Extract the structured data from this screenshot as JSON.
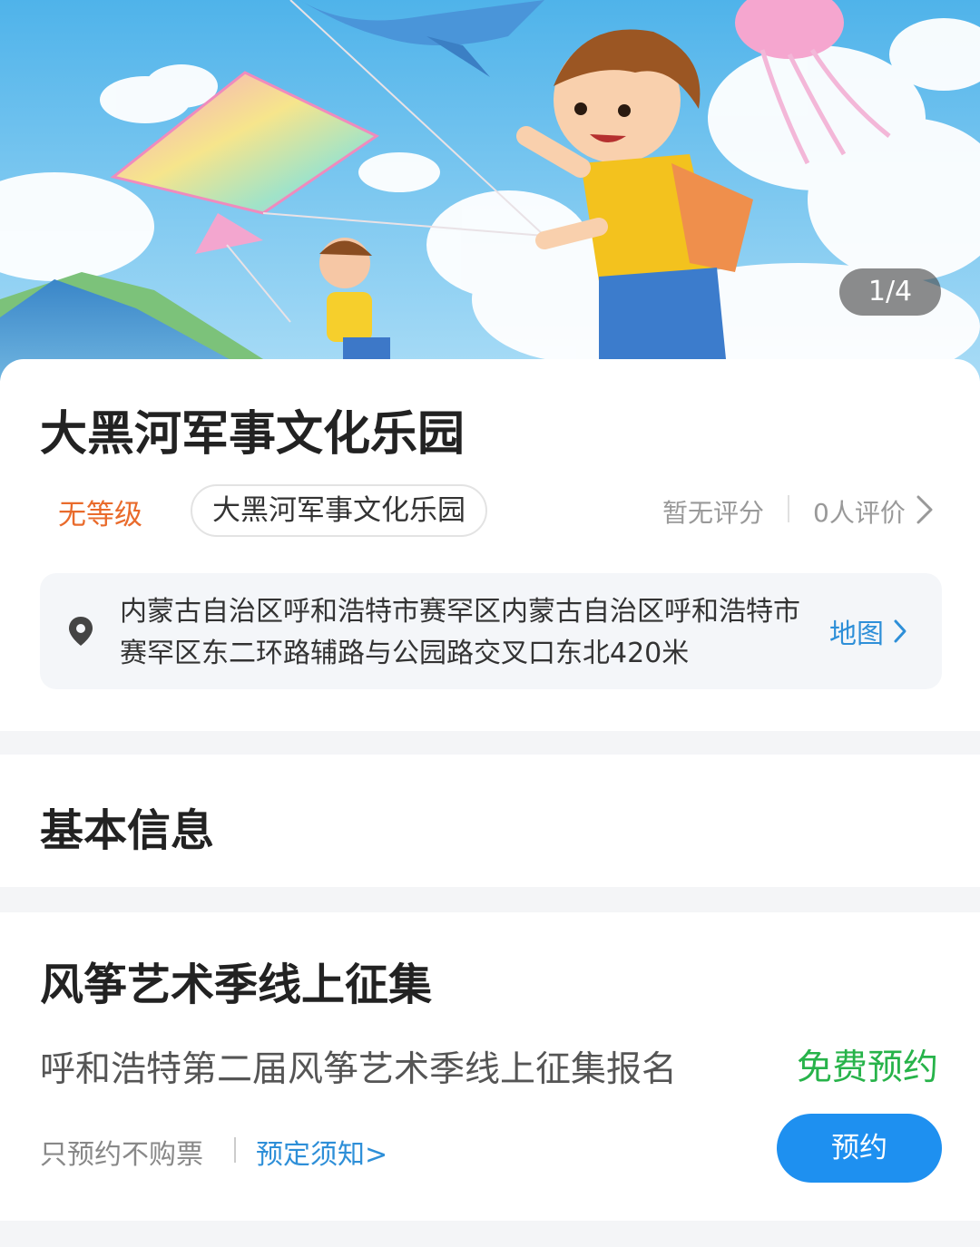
{
  "banner": {
    "counter": "1/4",
    "image_icon": "kite-children-illustration"
  },
  "venue": {
    "title": "大黑河军事文化乐园",
    "level": "无等级",
    "name_chip": "大黑河军事文化乐园",
    "rating": "暂无评分",
    "review_count": "0人评价",
    "address": "内蒙古自治区呼和浩特市赛罕区内蒙古自治区呼和浩特市赛罕区东二环路辅路与公园路交叉口东北420米",
    "map_label": "地图"
  },
  "basic_info": {
    "title": "基本信息"
  },
  "event": {
    "title": "风筝艺术季线上征集",
    "subtitle": "呼和浩特第二届风筝艺术季线上征集报名",
    "price": "免费预约",
    "note": "只预约不购票",
    "notice_link": "预定须知>",
    "book_label": "预约"
  },
  "colors": {
    "accent_blue": "#1e90f0",
    "link_blue": "#2e8fd8",
    "level_orange": "#e96b2c",
    "free_green": "#27b34a"
  }
}
